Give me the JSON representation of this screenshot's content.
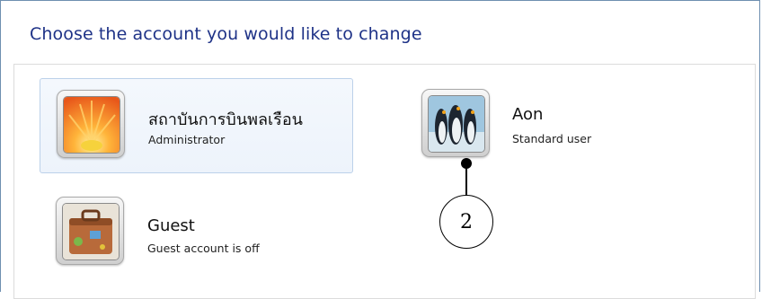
{
  "header": {
    "title": "Choose the account you would like to change"
  },
  "accounts": [
    {
      "name": "สถาบันการบินพลเรือน",
      "role": "Administrator",
      "picture": "flower-icon",
      "selected": true
    },
    {
      "name": "Aon",
      "role": "Standard user",
      "picture": "penguins-icon",
      "selected": false
    },
    {
      "name": "Guest",
      "role": "Guest account is off",
      "picture": "suitcase-icon",
      "selected": false
    }
  ],
  "callout": {
    "label": "2"
  },
  "colors": {
    "heading": "#1e3287",
    "selection_fill": "#edf3fb",
    "selection_border": "#bcd1ea"
  }
}
